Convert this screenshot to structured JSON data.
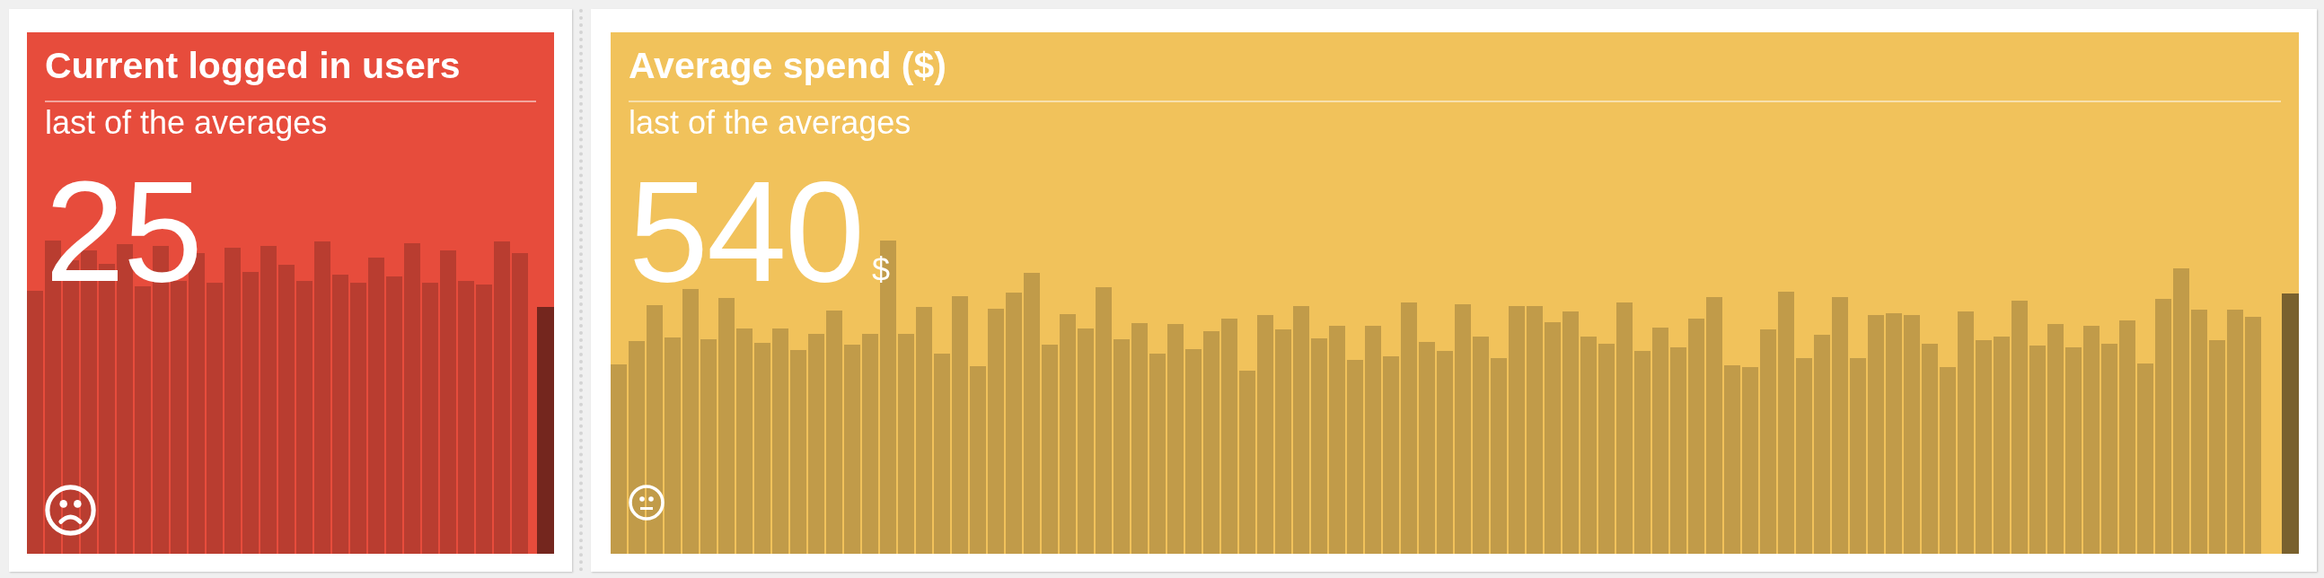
{
  "widgets": [
    {
      "title": "Current logged in users",
      "subtitle": "last of the averages",
      "value": "25",
      "color": "#e74c3c",
      "kind": "critical"
    },
    {
      "title": "Average spend ($)",
      "subtitle": "last of the averages",
      "value": "540",
      "unit": "$",
      "color": "#f1c25b",
      "kind": "warning"
    }
  ]
}
